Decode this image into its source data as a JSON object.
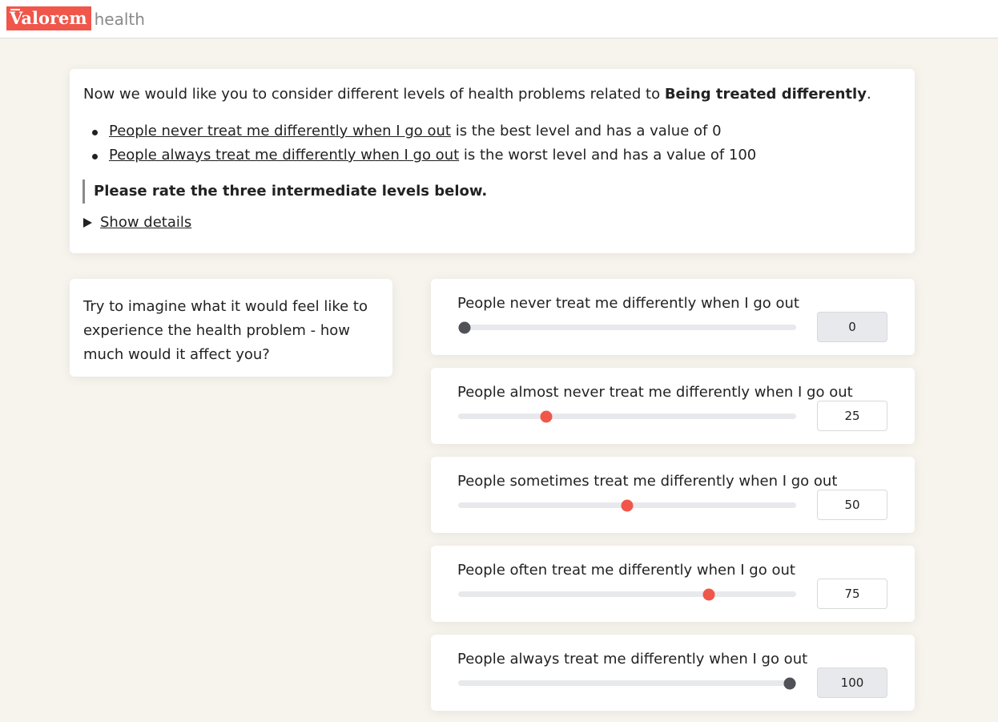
{
  "brand": {
    "name": "Valorem",
    "sub": "health"
  },
  "intro": {
    "text_before": "Now we would like you to consider different levels of health problems related to ",
    "topic": "Being treated differently",
    "text_after": ".",
    "best": {
      "level": "People never treat me differently when I go out",
      "suffix": " is the best level and has a value of 0"
    },
    "worst": {
      "level": "People always treat me differently when I go out",
      "suffix": " is the worst level and has a value of 100"
    },
    "instruction": "Please rate the three intermediate levels below.",
    "details_label": "Show details"
  },
  "hint": {
    "text": "Try to imagine what it would feel like to experience the health problem - how much would it affect you?"
  },
  "ratings": [
    {
      "label": "People never treat me differently when I go out",
      "value": "0",
      "fraction": 0.0,
      "editable": false
    },
    {
      "label": "People almost never treat me differently when I go out",
      "value": "25",
      "fraction": 0.25,
      "editable": true
    },
    {
      "label": "People sometimes treat me differently when I go out",
      "value": "50",
      "fraction": 0.5,
      "editable": true
    },
    {
      "label": "People often treat me differently when I go out",
      "value": "75",
      "fraction": 0.75,
      "editable": true
    },
    {
      "label": "People always treat me differently when I go out",
      "value": "100",
      "fraction": 1.0,
      "editable": false
    }
  ],
  "colors": {
    "accent": "#f0564a",
    "fixed_thumb": "#4f5156",
    "background": "#f7f4ed"
  }
}
